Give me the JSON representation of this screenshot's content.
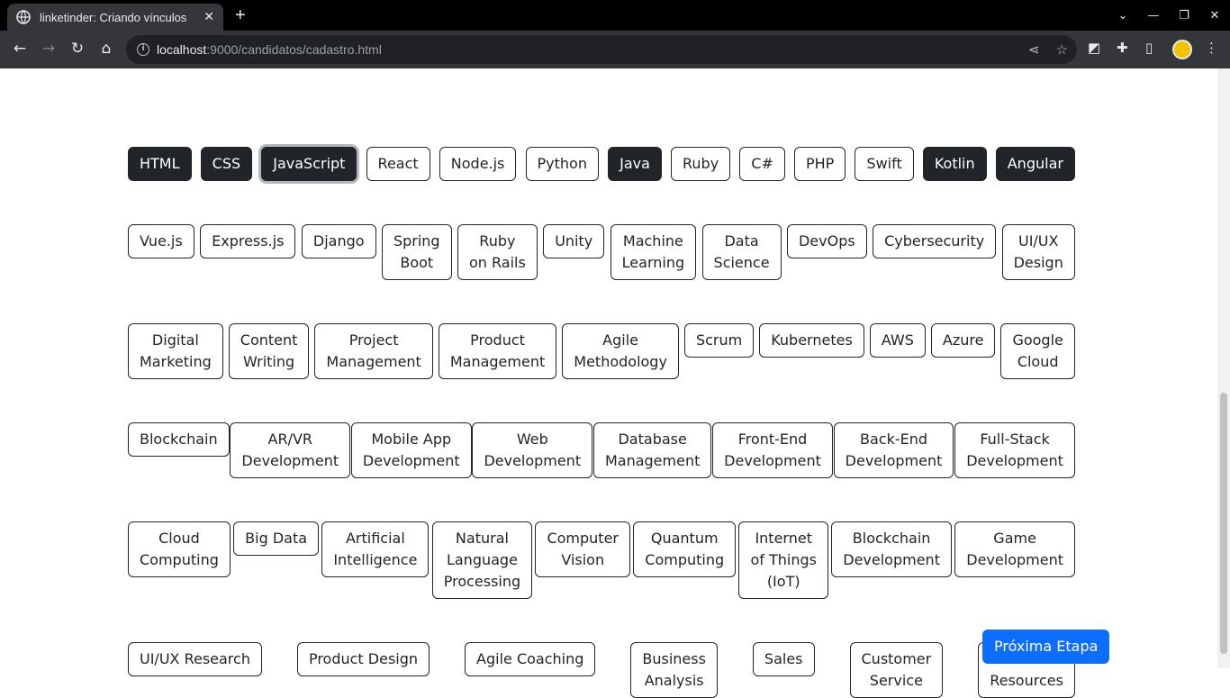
{
  "browser": {
    "tab_title": "linketinder: Criando vínculos",
    "new_tab": "+",
    "url_host": "localhost",
    "url_path": ":9000/candidatos/cadastro.html"
  },
  "skills_row1": [
    {
      "label": "HTML",
      "active": true
    },
    {
      "label": "CSS",
      "active": true
    },
    {
      "label": "JavaScript",
      "active": true,
      "focus": true
    },
    {
      "label": "React",
      "active": false
    },
    {
      "label": "Node.js",
      "active": false
    },
    {
      "label": "Python",
      "active": false
    },
    {
      "label": "Java",
      "active": true
    },
    {
      "label": "Ruby",
      "active": false
    },
    {
      "label": "C#",
      "active": false
    },
    {
      "label": "PHP",
      "active": false
    },
    {
      "label": "Swift",
      "active": false
    },
    {
      "label": "Kotlin",
      "active": true
    },
    {
      "label": "Angular",
      "active": true
    }
  ],
  "skills": [
    "Vue.js",
    "Express.js",
    "Django",
    "Spring\nBoot",
    "Ruby\non Rails",
    "Unity",
    "Machine\nLearning",
    "Data\nScience",
    "DevOps",
    "Cybersecurity",
    "UI/UX\nDesign",
    "Digital\nMarketing",
    "Content\nWriting",
    "Project\nManagement",
    "Product\nManagement",
    "Agile\nMethodology",
    "Scrum",
    "Kubernetes",
    "AWS",
    "Azure",
    "Google\nCloud",
    "Blockchain",
    "AR/VR\nDevelopment",
    "Mobile App\nDevelopment",
    "Web\nDevelopment",
    "Database\nManagement",
    "Front-End\nDevelopment",
    "Back-End\nDevelopment",
    "Full-Stack\nDevelopment",
    "Cloud\nComputing",
    "Big Data",
    "Artificial\nIntelligence",
    "Natural\nLanguage\nProcessing",
    "Computer\nVision",
    "Quantum\nComputing",
    "Internet\nof Things\n(IoT)",
    "Blockchain\nDevelopment",
    "Game\nDevelopment",
    "UI/UX Research",
    "Product Design",
    "Agile Coaching",
    "Business\nAnalysis",
    "Sales",
    "Customer\nService",
    "Human\nResources"
  ],
  "next_button": "Próxima Etapa",
  "colors": {
    "dark": "#212529",
    "primary": "#0d6efd"
  }
}
